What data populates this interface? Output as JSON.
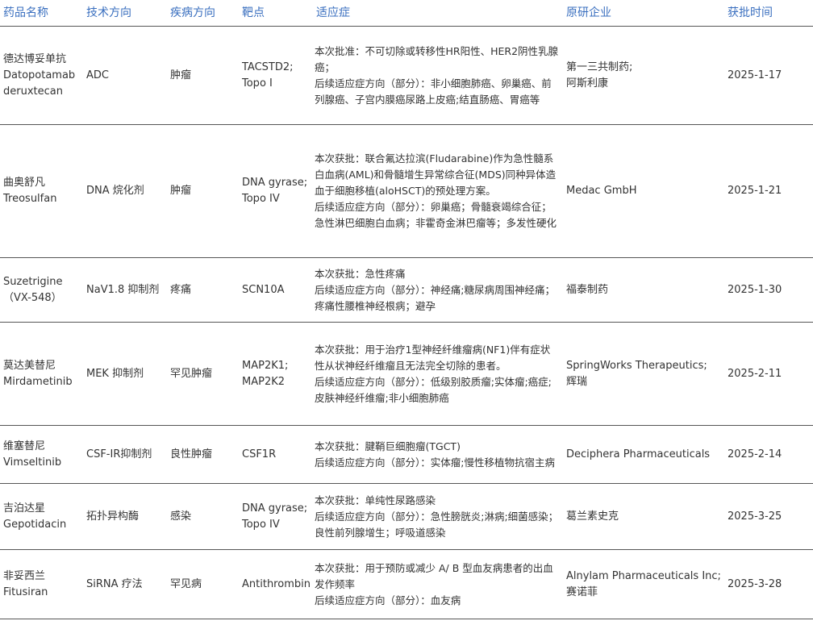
{
  "headers": {
    "name": "药品名称",
    "tech": "技术方向",
    "disease": "疾病方向",
    "target": "靶点",
    "indication": "适应症",
    "company": "原研企业",
    "date": "获批时间"
  },
  "rows": [
    {
      "name_cn": "德达博妥单抗",
      "name_en": "Datopotamab deruxtecan",
      "tech": "ADC",
      "disease": "肿瘤",
      "target": [
        "TACSTD2;",
        "Topo I"
      ],
      "indication": [
        "本次批准：不可切除或转移性HR阳性、HER2阴性乳腺癌；",
        "后续适应症方向（部分）：非小细胞肺癌、卵巢癌、前列腺癌、子宫内膜癌尿路上皮癌;结直肠癌、胃癌等"
      ],
      "company": [
        "第一三共制药;",
        "阿斯利康"
      ],
      "date": "2025-1-17"
    },
    {
      "name_cn": "曲奥舒凡",
      "name_en": "Treosulfan",
      "tech": "DNA 烷化剂",
      "disease": "肿瘤",
      "target": [
        "DNA gyrase;",
        "Topo IV"
      ],
      "indication": [
        "本次获批：联合氟达拉滨(Fludarabine)作为急性髓系白血病(AML)和骨髓增生异常综合征(MDS)同种异体造血于细胞移植(aloHSCT)的预处理方案。",
        "后续适应症方向（部分）：卵巢癌；骨髓衰竭综合征；急性淋巴细胞白血病；非霍奇金淋巴瘤等；多发性硬化"
      ],
      "company": [
        "Medac GmbH"
      ],
      "date": "2025-1-21"
    },
    {
      "name_cn": "Suzetrigine",
      "name_en": "（VX-548）",
      "tech": "NaV1.8 抑制剂",
      "disease": "疼痛",
      "target": [
        "SCN10A"
      ],
      "indication": [
        "本次获批：急性疼痛",
        "后续适应症方向（部分）：神经痛;糖尿病周围神经痛；疼痛性腰椎神经根病；避孕"
      ],
      "company": [
        "福泰制药"
      ],
      "date": "2025-1-30"
    },
    {
      "name_cn": "莫达美替尼",
      "name_en": "Mirdametinib",
      "tech": "MEK 抑制剂",
      "disease": "罕见肿瘤",
      "target": [
        "MAP2K1;",
        "MAP2K2"
      ],
      "indication": [
        "本次获批：用于治疗1型神经纤维瘤病(NF1)伴有症状性从状神经纤维瘤且无法完全切除的患者。",
        "后续适应症方向（部分）：低级别胶质瘤;实体瘤;癌症;皮肤神经纤维瘤;非小细胞肺癌"
      ],
      "company": [
        "SpringWorks Therapeutics;",
        "辉瑞"
      ],
      "date": "2025-2-11"
    },
    {
      "name_cn": "维塞替尼",
      "name_en": "Vimseltinib",
      "tech": "CSF-IR抑制剂",
      "disease": "良性肿瘤",
      "target": [
        "CSF1R"
      ],
      "indication": [
        "本次获批：腱鞘巨细胞瘤(TGCT)",
        "后续适应症方向（部分）：实体瘤;慢性移植物抗宿主病"
      ],
      "company": [
        "Deciphera Pharmaceuticals"
      ],
      "date": "2025-2-14"
    },
    {
      "name_cn": "吉泊达星",
      "name_en": "Gepotidacin",
      "tech": "拓扑异构酶",
      "disease": "感染",
      "target": [
        "DNA gyrase;",
        "Topo IV"
      ],
      "indication": [
        "本次获批：单纯性尿路感染",
        "后续适应症方向（部分）：急性膀胱炎;淋病;细菌感染；良性前列腺增生；呼吸道感染"
      ],
      "company": [
        "葛兰素史克"
      ],
      "date": "2025-3-25"
    },
    {
      "name_cn": "非妥西兰",
      "name_en": "Fitusiran",
      "tech": "SiRNA 疗法",
      "disease": "罕见病",
      "target": [
        "Antithrombin"
      ],
      "indication": [
        "本次获批：用于预防或减少 A/ B 型血友病患者的出血发作频率",
        "后续适应症方向（部分）：血友病"
      ],
      "company": [
        "Alnylam Pharmaceuticals Inc;",
        "赛诺菲"
      ],
      "date": "2025-3-28"
    }
  ]
}
